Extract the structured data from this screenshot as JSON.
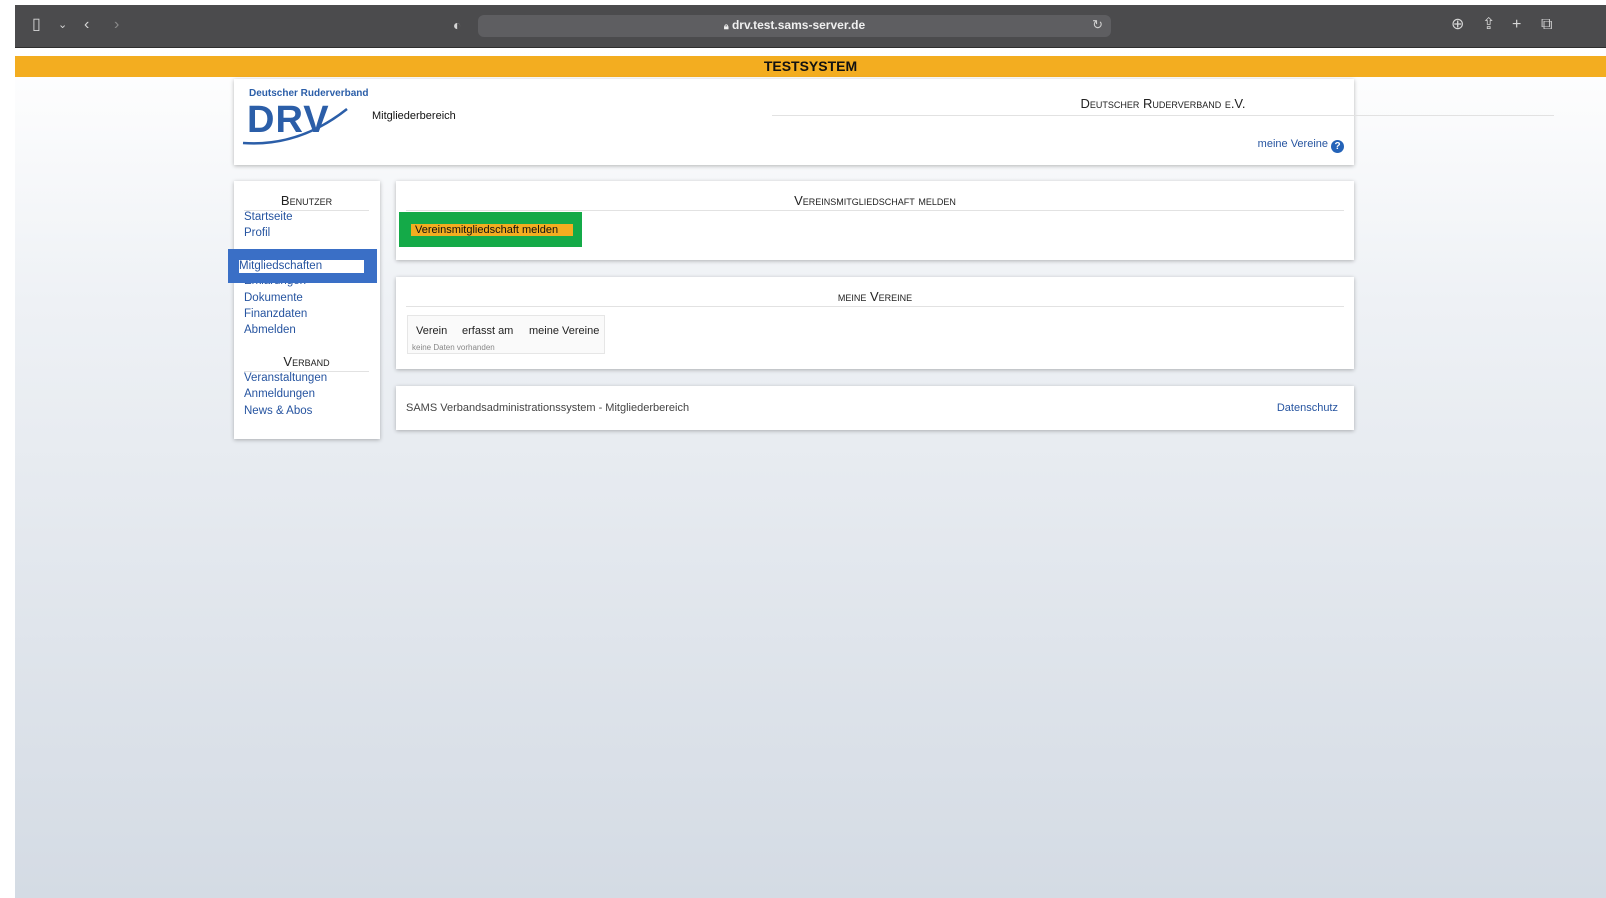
{
  "browser": {
    "url": "drv.test.sams-server.de",
    "icons": [
      "sidebar-icon",
      "chevron-down-icon",
      "back-icon",
      "forward-icon",
      "shield-icon",
      "lock-icon",
      "reload-icon",
      "download-icon",
      "share-icon",
      "new-tab-icon",
      "tabs-icon"
    ]
  },
  "banner": {
    "text": "TESTSYSTEM"
  },
  "header": {
    "logo_org": "Deutscher Ruderverband",
    "logo_text": "DRV",
    "subtitle": "Mitgliederbereich",
    "title": "Deutscher Ruderverband e.V.",
    "meine_vereine": "meine Vereine",
    "help_icon": "?"
  },
  "sidebar": {
    "benutzer_heading": "Benutzer",
    "benutzer_items": [
      "Startseite",
      "Profil",
      "Mitgliedschaften",
      "Erklärungen",
      "Dokumente",
      "Finanzdaten",
      "Abmelden"
    ],
    "verband_heading": "Verband",
    "verband_items": [
      "Veranstaltungen",
      "Anmeldungen",
      "News & Abos"
    ]
  },
  "main": {
    "melden": {
      "title": "Vereinsmitgliedschaft melden",
      "button": "Vereinsmitgliedschaft melden"
    },
    "vereine": {
      "title": "meine Vereine",
      "columns": [
        "Verein",
        "erfasst am",
        "meine Vereine"
      ],
      "empty": "keine Daten vorhanden"
    },
    "footer": {
      "text": "SAMS Verbandsadministrationssystem - Mitgliederbereich",
      "link": "Datenschutz"
    }
  },
  "colors": {
    "accent_orange": "#f3ad20",
    "highlight_green": "#14aa48",
    "highlight_blue": "#3a6fc6",
    "link_blue": "#2654a0"
  }
}
